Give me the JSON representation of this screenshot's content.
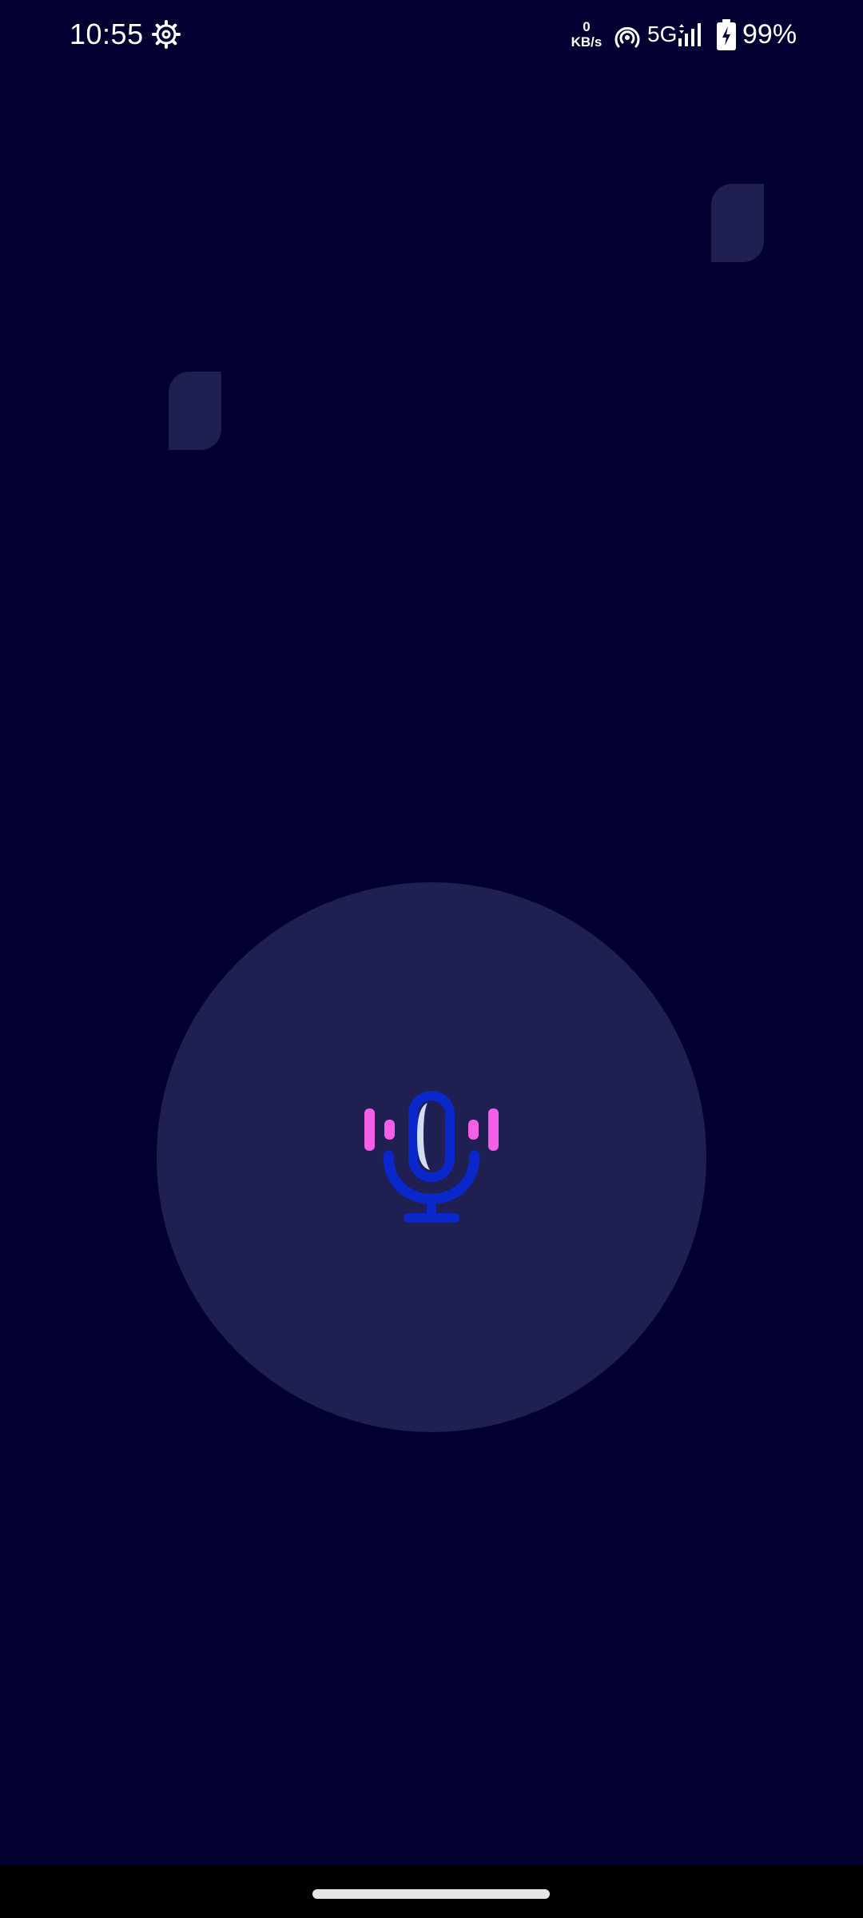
{
  "status_bar": {
    "time": "10:55",
    "net_speed_value": "0",
    "net_speed_unit": "KB/s",
    "network_type": "5G",
    "battery_percent": "99%",
    "icons": [
      "settings-gear-icon",
      "hotspot-icon",
      "signal-strength-icon",
      "battery-charging-icon"
    ]
  },
  "main": {
    "mic_button_icon": "microphone-with-sound-waves-icon"
  },
  "colors": {
    "background": "#010030",
    "circle": "#1f1f52",
    "mic_blue": "#0a27cc",
    "mic_highlight": "#d4dbf5",
    "wave_pink": "#f55ee6",
    "nav_bar": "#000000"
  }
}
